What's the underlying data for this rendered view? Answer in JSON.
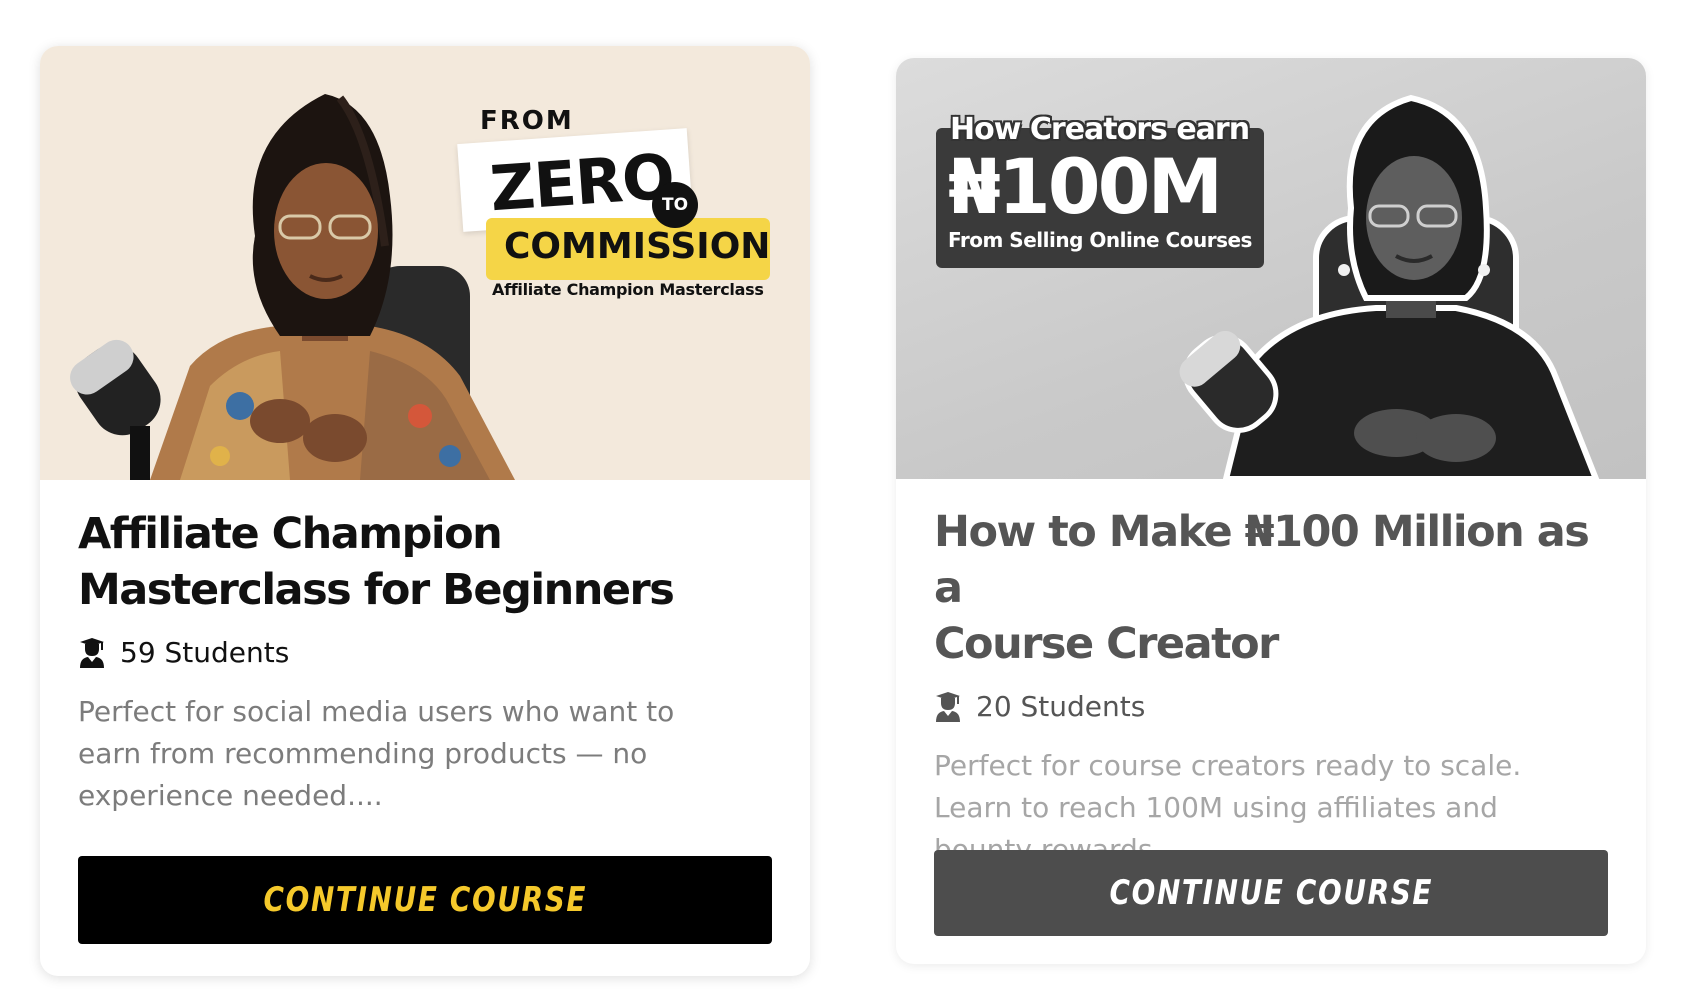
{
  "colors": {
    "card1_cta_bg": "#000000",
    "card1_cta_text": "#f5c92b",
    "card2_cta_bg": "#4d4d4d",
    "card2_cta_text": "#ffffff",
    "accent_yellow": "#f5d547"
  },
  "courses": [
    {
      "thumbnail": {
        "from": "FROM",
        "zero": "ZERO",
        "to": "TO",
        "commission": "COMMISSION",
        "subtitle": "Affiliate Champion Masterclass"
      },
      "title_line1": "Affiliate Champion",
      "title_line2": "Masterclass for Beginners",
      "students_icon": "student-icon",
      "students": "59 Students",
      "description_line1": "Perfect for social media users who want to",
      "description_line2": "earn from recommending products — no",
      "description_line3": "experience needed....",
      "cta_label": "CONTINUE COURSE"
    },
    {
      "thumbnail": {
        "headline": "How Creators earn",
        "amount": "₦100M",
        "subtitle": "From Selling Online Courses"
      },
      "title_line1": "How to Make ₦100 Million as a",
      "title_line2": "Course Creator",
      "students_icon": "student-icon",
      "students": "20 Students",
      "description_line1": "Perfect for course creators ready to scale.",
      "description_line2": "Learn to reach 100M using affiliates and",
      "description_line3": "bounty rewards....",
      "cta_label": "CONTINUE COURSE"
    }
  ]
}
